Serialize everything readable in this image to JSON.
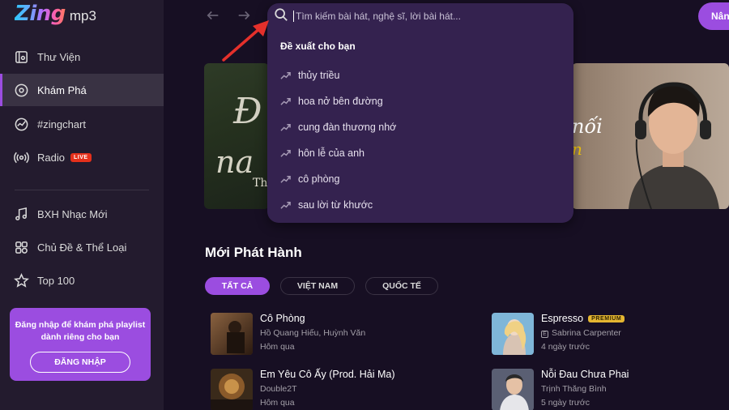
{
  "app": {
    "logo_main": "Zing",
    "logo_sub": "mp3"
  },
  "sidebar": {
    "items": [
      {
        "label": "Thư Viện",
        "icon": "library-icon"
      },
      {
        "label": "Khám Phá",
        "icon": "disc-icon",
        "active": true
      },
      {
        "label": "#zingchart",
        "icon": "chart-icon"
      },
      {
        "label": "Radio",
        "icon": "radio-icon",
        "badge": "LIVE"
      },
      {
        "label": "BXH Nhạc Mới",
        "icon": "music-note-icon"
      },
      {
        "label": "Chủ Đề & Thể Loại",
        "icon": "category-icon"
      },
      {
        "label": "Top 100",
        "icon": "star-icon"
      }
    ],
    "login_prompt": "Đăng nhập để khám phá playlist dành riêng cho bạn",
    "login_button": "ĐĂNG NHẬP"
  },
  "topbar": {
    "upgrade_button": "Nân"
  },
  "search": {
    "placeholder": "Tìm kiếm bài hát, nghệ sĩ, lời bài hát...",
    "suggest_title": "Đề xuất cho bạn",
    "suggestions": [
      "thủy triều",
      "hoa nở bên đường",
      "cung đàn thương nhớ",
      "hôn lễ của anh",
      "cô phòng",
      "sau lời từ khước"
    ]
  },
  "banners": {
    "left_text": [
      "Đ",
      "na",
      "Th"
    ],
    "right_text": [
      "nối",
      "n"
    ]
  },
  "new_releases": {
    "title": "Mới Phát Hành",
    "filters": [
      "TẤT CẢ",
      "VIỆT NAM",
      "QUỐC TẾ"
    ],
    "songs": [
      {
        "name": "Cô Phòng",
        "artist": "Hồ Quang Hiếu, Huỳnh Văn",
        "time": "Hôm qua",
        "cover_text": "CÔ PHÒNG"
      },
      {
        "name": "Espresso",
        "badge": "PREMIUM",
        "explicit": "E",
        "artist": "Sabrina Carpenter",
        "time": "4 ngày trước"
      },
      {
        "name": "Em Yêu Cô Ấy (Prod. Hải Ma)",
        "artist": "Double2T",
        "time": "Hôm qua"
      },
      {
        "name": "Nỗi Đau Chưa Phai",
        "artist": "Trịnh Thăng Bình",
        "time": "5 ngày trước"
      }
    ]
  },
  "colors": {
    "accent": "#9b4de0",
    "background": "#170f23",
    "sidebar": "#231b2e",
    "search_popup": "#34224f",
    "live_badge": "#e5301b",
    "premium_badge": "#e5b631",
    "annotation_arrow": "#e5302b"
  }
}
